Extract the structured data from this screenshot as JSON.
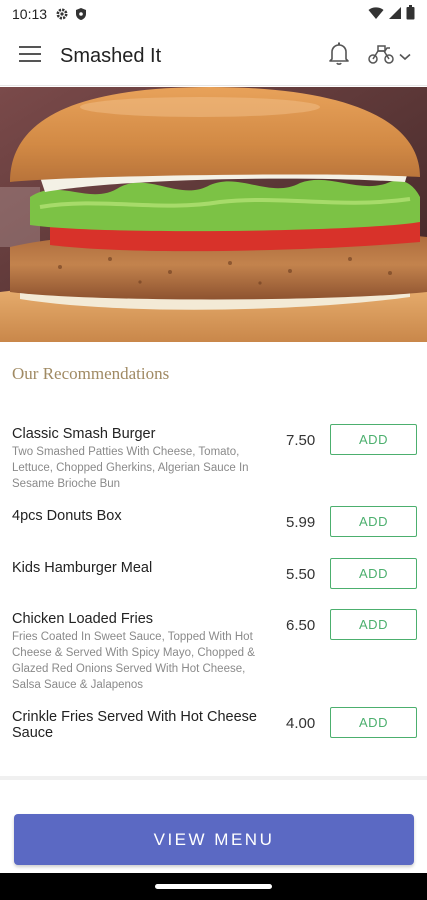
{
  "status_bar": {
    "time": "10:13",
    "icons": [
      "gear-icon",
      "shield-icon",
      "wifi-icon",
      "signal-icon",
      "battery-icon"
    ]
  },
  "app_bar": {
    "title": "Smashed It",
    "icons": [
      "hamburger-menu-icon",
      "bell-icon",
      "scooter-icon",
      "chevron-down-icon"
    ]
  },
  "hero": {
    "image": "burger-photo"
  },
  "recommendations": {
    "title": "Our Recommendations",
    "items": [
      {
        "name": "Classic Smash Burger",
        "description": "Two Smashed Patties With Cheese, Tomato, Lettuce, Chopped Gherkins, Algerian Sauce In Sesame Brioche Bun",
        "price": "7.50",
        "button": "ADD"
      },
      {
        "name": "4pcs Donuts Box",
        "description": "",
        "price": "5.99",
        "button": "ADD"
      },
      {
        "name": "Kids Hamburger Meal",
        "description": "",
        "price": "5.50",
        "button": "ADD"
      },
      {
        "name": "Chicken Loaded Fries",
        "description": "Fries Coated In Sweet Sauce, Topped With Hot Cheese & Served With Spicy Mayo, Chopped & Glazed Red Onions Served With Hot Cheese, Salsa Sauce & Jalapenos",
        "price": "6.50",
        "button": "ADD"
      },
      {
        "name": "Crinkle Fries Served With Hot Cheese Sauce",
        "description": "",
        "price": "4.00",
        "button": "ADD"
      }
    ]
  },
  "view_menu": {
    "label": "VIEW MENU"
  },
  "colors": {
    "accent": "#5b69c3",
    "add_green": "#4caf6e",
    "section_title": "#a08a63"
  }
}
